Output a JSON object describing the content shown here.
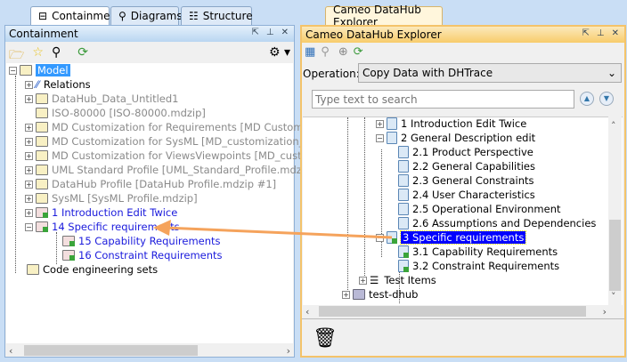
{
  "left": {
    "tabs": [
      {
        "label": "Containment",
        "icon": "containment-icon"
      },
      {
        "label": "Diagrams",
        "icon": "diagrams-icon"
      },
      {
        "label": "Structure",
        "icon": "structure-icon"
      }
    ],
    "header": "Containment",
    "tree": [
      {
        "label": "Model",
        "style": "selected",
        "icon": "model-icon"
      },
      {
        "label": "Relations",
        "style": "normal",
        "icon": "relations-icon"
      },
      {
        "label": "DataHub_Data_Untitled1",
        "style": "gray",
        "icon": "folder-icon"
      },
      {
        "label": "ISO-80000 [ISO-80000.mdzip]",
        "style": "gray",
        "icon": "model-library-icon"
      },
      {
        "label": "MD Customization for Requirements [MD Customization",
        "style": "gray",
        "icon": "package-icon"
      },
      {
        "label": "MD Customization for SysML [MD_customization_for_Sy",
        "style": "gray",
        "icon": "package-icon"
      },
      {
        "label": "MD Customization for ViewsViewpoints [MD_customizati",
        "style": "gray",
        "icon": "package-icon"
      },
      {
        "label": "UML Standard Profile [UML_Standard_Profile.mdzip]",
        "style": "gray",
        "icon": "package-icon"
      },
      {
        "label": "DataHub Profile [DataHub Profile.mdzip #1]",
        "style": "gray",
        "icon": "profile-icon"
      },
      {
        "label": "SysML [SysML Profile.mdzip]",
        "style": "gray",
        "icon": "profile-icon"
      },
      {
        "label": "1 Introduction Edit Twice",
        "style": "blue",
        "icon": "requirement-icon"
      },
      {
        "label": "14 Specific requirements",
        "style": "blue",
        "icon": "requirement-icon"
      },
      {
        "label": "15 Capability Requirements",
        "style": "blue",
        "icon": "requirement-icon"
      },
      {
        "label": "16 Constraint Requirements",
        "style": "blue",
        "icon": "requirement-icon"
      },
      {
        "label": "Code engineering sets",
        "style": "normal",
        "icon": "code-sets-icon"
      }
    ]
  },
  "right": {
    "tab": "Cameo DataHub Explorer",
    "header": "Cameo DataHub Explorer",
    "operation_label": "Operation:",
    "operation_value": "Copy Data with DHTrace",
    "search_placeholder": "Type text to search",
    "tree": [
      {
        "label": "1 Introduction Edit Twice"
      },
      {
        "label": "2 General Description edit"
      },
      {
        "label": "2.1 Product Perspective"
      },
      {
        "label": "2.2 General Capabilities"
      },
      {
        "label": "2.3 General Constraints"
      },
      {
        "label": "2.4 User Characteristics"
      },
      {
        "label": "2.5 Operational Environment"
      },
      {
        "label": "2.6 Assumptions and Dependencies"
      },
      {
        "label": "3 Specific requirements"
      },
      {
        "label": "3.1 Capability Requirements"
      },
      {
        "label": "3.2 Constraint Requirements"
      },
      {
        "label": "Test Items"
      },
      {
        "label": "test-dhub"
      }
    ]
  },
  "colors": {
    "arrow": "#f5a35c",
    "selection": "#3399ff",
    "selection_right": "#0000ff",
    "link": "#1a1adc"
  }
}
